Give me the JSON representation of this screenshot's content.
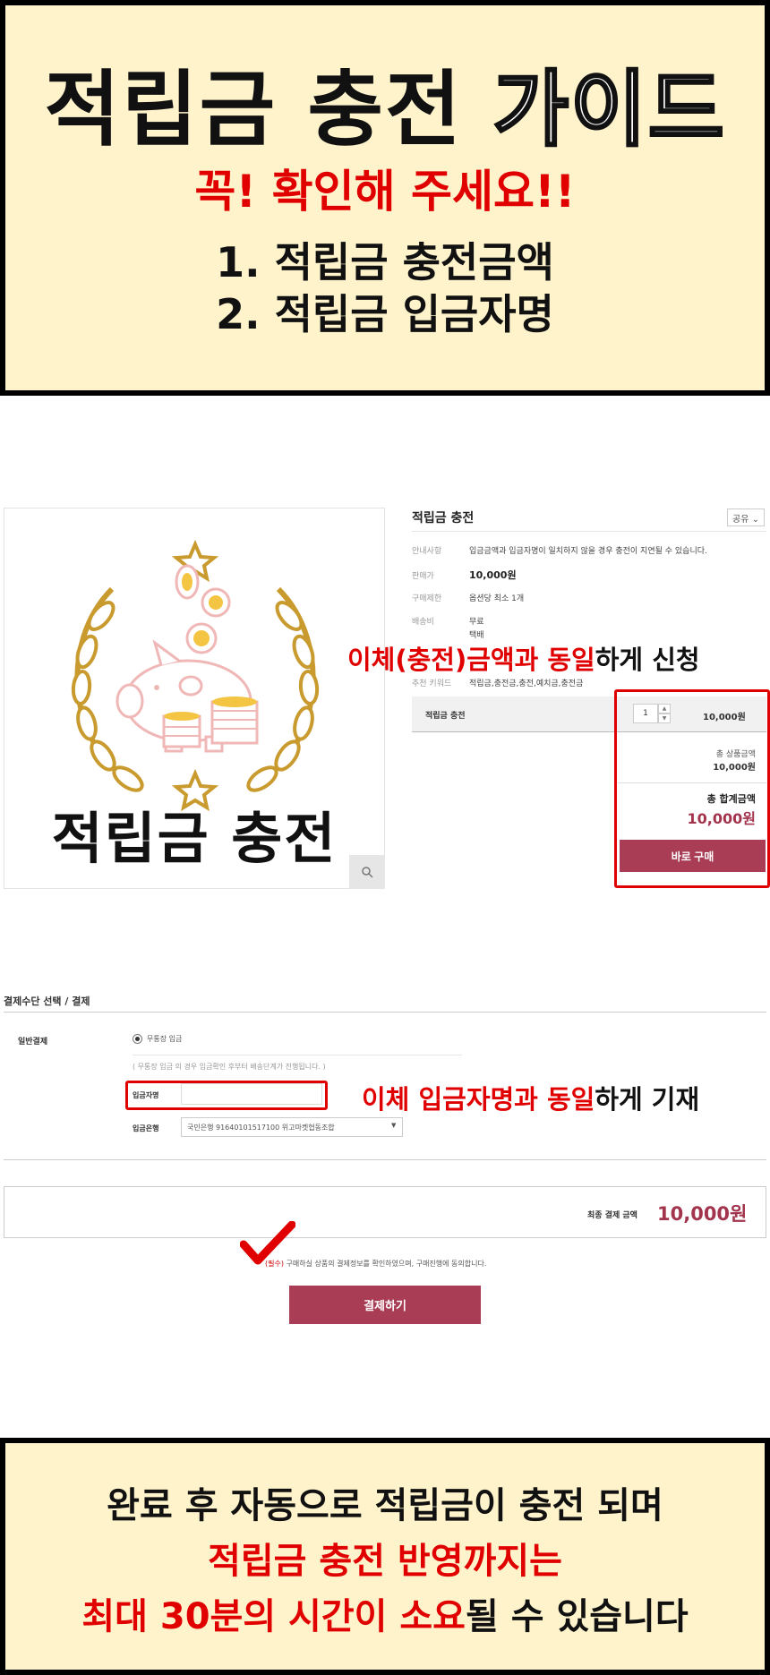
{
  "top_banner": {
    "title_part1": "적립금 충전",
    "title_part2": "가이드",
    "check_line": "꼭! 확인해 주세요!!",
    "step1": "1. 적립금 충전금액",
    "step2": "2. 적립금 입금자명"
  },
  "product": {
    "image_caption": "적립금 충전",
    "title": "적립금 충전",
    "share_label": "공유 ⌄",
    "info": [
      {
        "label": "안내사항",
        "value": "입금금액과 입금자명이 일치하지 않을 경우 충전이 지연될 수 있습니다."
      },
      {
        "label": "판매가",
        "value": "10,000원"
      },
      {
        "label": "구매제한",
        "value": "옵션당 최소 1개"
      },
      {
        "label": "배송비",
        "value": "무료"
      },
      {
        "label": "",
        "value": "택배"
      },
      {
        "label": "추천 키워드",
        "value": "적립금,충전금,충전,예치금,충전금"
      }
    ],
    "option_name": "적립금 충전",
    "quantity": "1",
    "option_price": "10,000원",
    "sum_label": "총 상품금액",
    "sum_value": "10,000원",
    "total_label": "총 합계금액",
    "total_value": "10,000원",
    "buy_label": "바로 구매"
  },
  "annotation1": {
    "red1": "이체(충전)금액과 동일",
    "black": "하게 신청"
  },
  "payment": {
    "header": "결제수단 선택 / 결제",
    "general_label": "일반결제",
    "method": "무통장 입금",
    "note": "( 무통장 입금 의 경우 입금확인 후부터 배송단계가 진행됩니다. )",
    "depositor_label": "입금자명",
    "depositor_value": "",
    "bank_label": "입금은행",
    "bank_value": "국민은행 91640101517100 위고마켓협동조합",
    "final_label": "최종 결제 금액",
    "final_value": "10,000원",
    "agree_required": "(필수)",
    "agree_text": " 구매하실 상품의 결제정보를 확인하였으며, 구매진행에 동의합니다.",
    "pay_button": "결제하기"
  },
  "annotation2": {
    "red1": "이체 입금자명과 동일",
    "black": "하게 기재"
  },
  "bottom_banner": {
    "line1": "완료 후 자동으로 적립금이 충전 되며",
    "line2": "적립금 충전 반영까지는",
    "line3_red": "최대 30분의 시간이 소요",
    "line3_black": "될 수 있습니다"
  },
  "colors": {
    "banner_bg": "#fff3cc",
    "accent_red": "#e00000",
    "button": "#a83d55",
    "price": "#a3344d"
  }
}
